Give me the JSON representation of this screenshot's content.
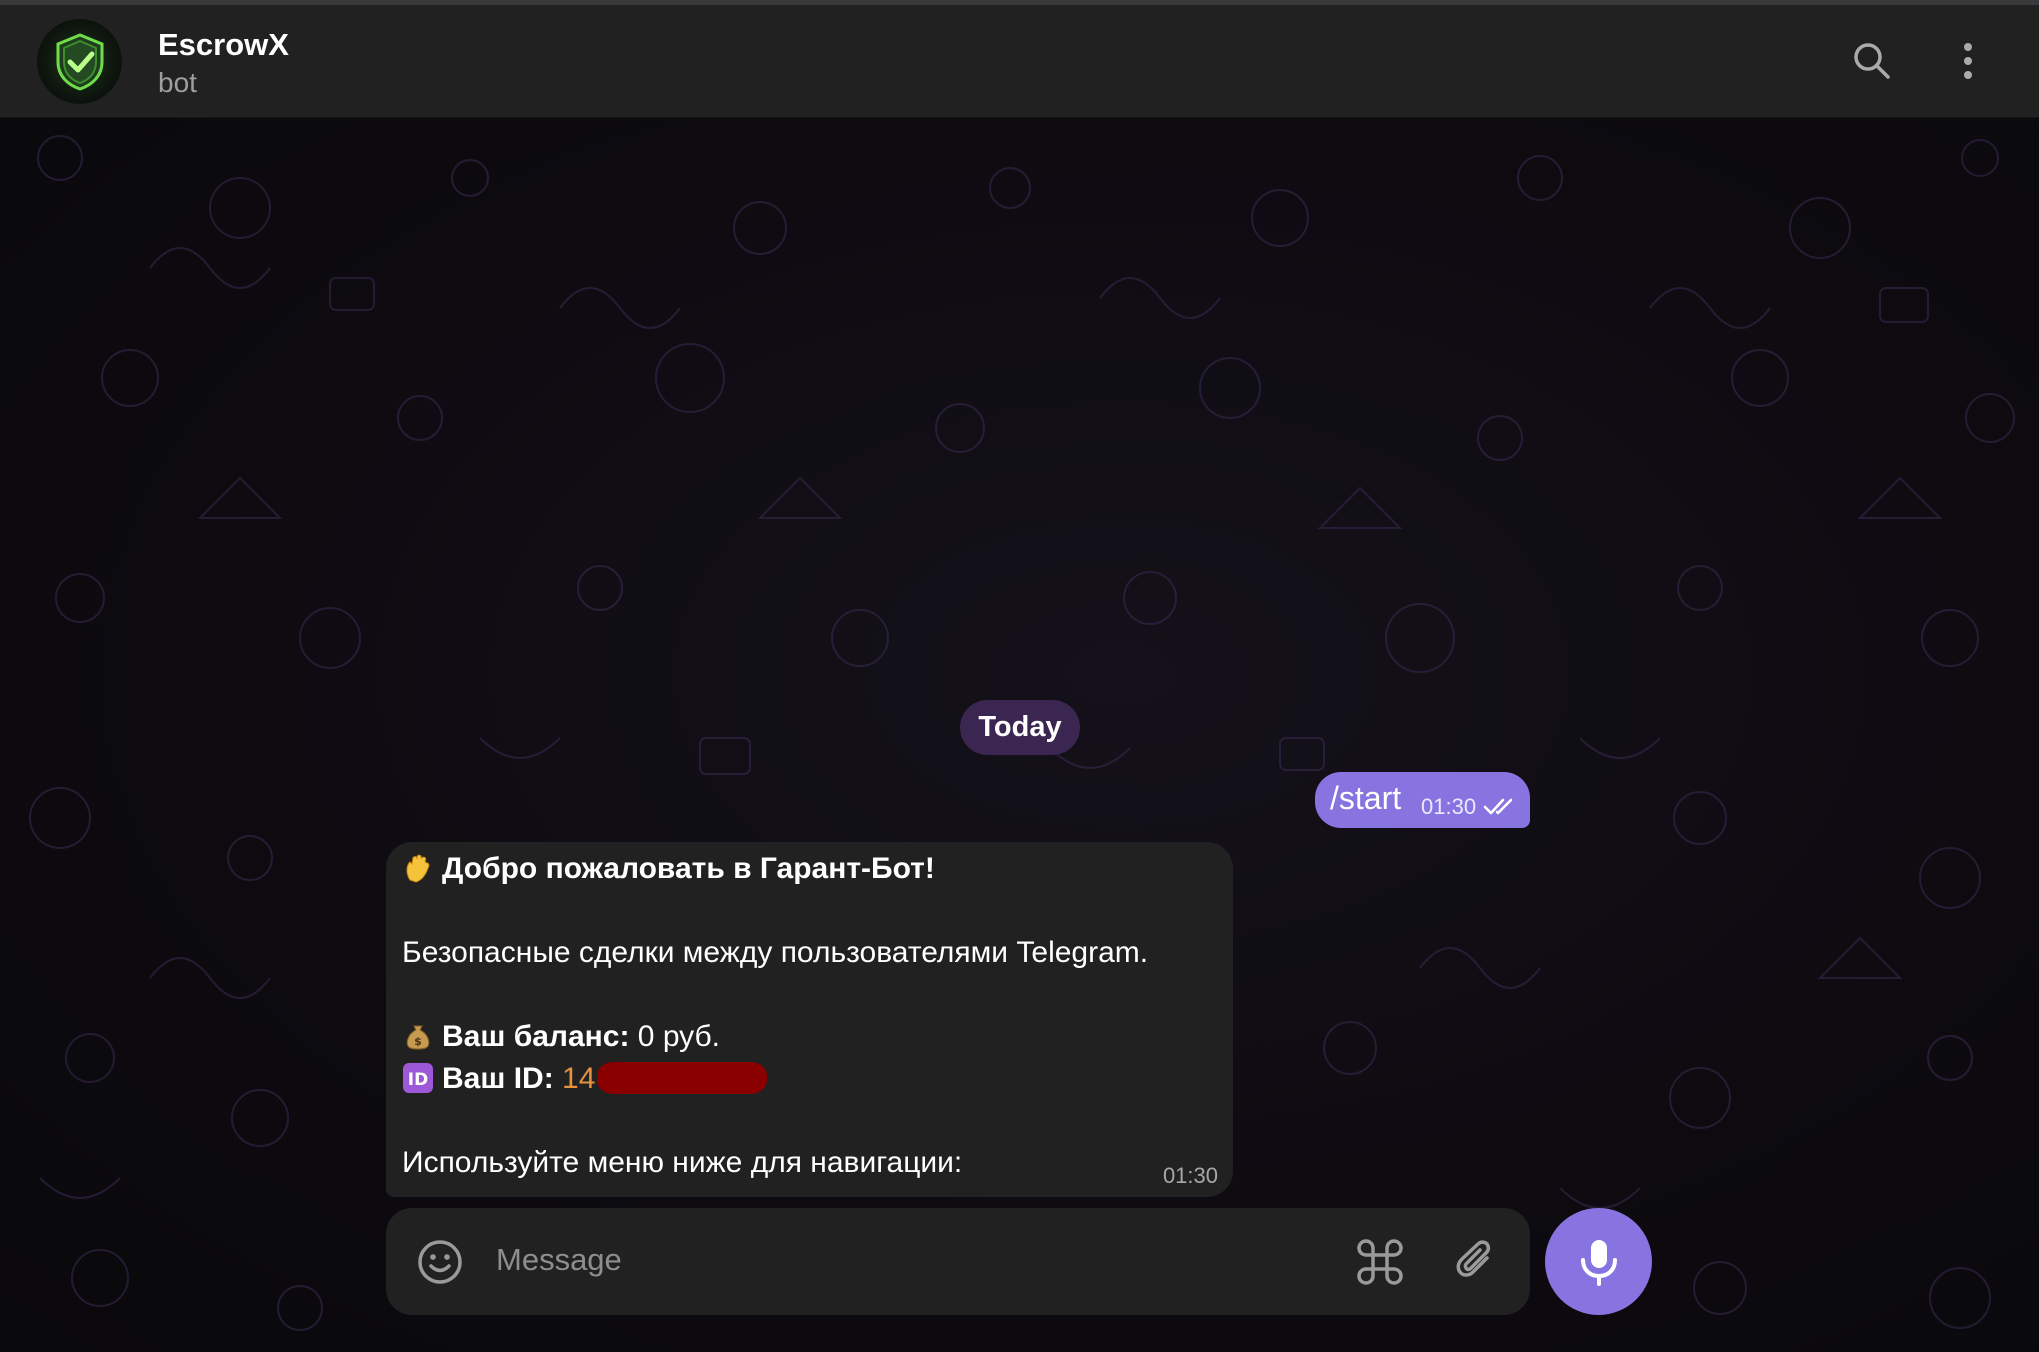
{
  "header": {
    "title": "EscrowX",
    "subtitle": "bot"
  },
  "chat": {
    "date_chip": "Today",
    "outgoing": {
      "text": "/start",
      "time": "01:30"
    },
    "incoming": {
      "title": "Добро пожаловать в Гарант-Бот!",
      "line_description": "Безопасные сделки между пользователями Telegram.",
      "balance_label": "Ваш баланс:",
      "balance_value": "0 руб.",
      "id_label": "Ваш ID:",
      "id_value": "14",
      "footer": "Используйте меню ниже для навигации:",
      "time": "01:30"
    }
  },
  "composer": {
    "placeholder": "Message"
  },
  "icons": {
    "avatar": "shield-check-icon",
    "search": "search-icon",
    "more": "more-vertical-icon",
    "emoji": "smiley-icon",
    "commands": "command-icon",
    "attach": "paperclip-icon",
    "mic": "microphone-icon",
    "ticks": "double-check-icon"
  },
  "colors": {
    "accent": "#8774e1",
    "header_bg": "#212121",
    "bubble_in": "#212121",
    "id_value": "#e5913d",
    "date_chip": "#3a2650"
  }
}
